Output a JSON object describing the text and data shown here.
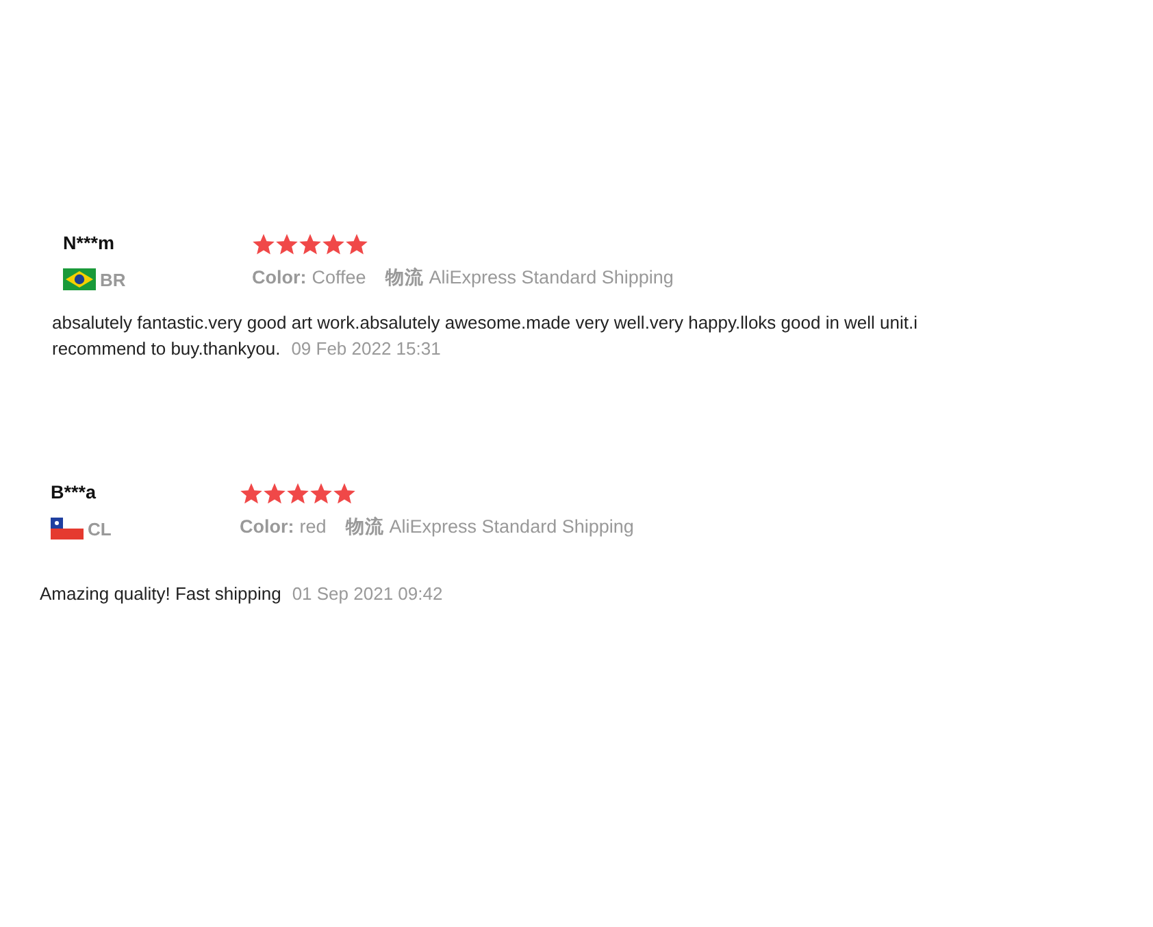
{
  "reviews": [
    {
      "name": "N***m",
      "kind": "brazil",
      "country": "BR",
      "stars": 5,
      "color_label": "Color:",
      "color_value": "Coffee",
      "shipping_label": "物流",
      "shipping_value": "AliExpress Standard Shipping",
      "text": "absalutely fantastic.very good art work.absalutely awesome.made very well.very happy.lloks good in well unit.i recommend to buy.thankyou.",
      "date": "09 Feb 2022 15:31"
    },
    {
      "name": "B***a",
      "kind": "chile",
      "country": "CL",
      "stars": 5,
      "color_label": "Color:",
      "color_value": "red",
      "shipping_label": "物流",
      "shipping_value": "AliExpress Standard Shipping",
      "text": "Amazing quality! Fast shipping",
      "date": "01 Sep 2021 09:42"
    }
  ]
}
